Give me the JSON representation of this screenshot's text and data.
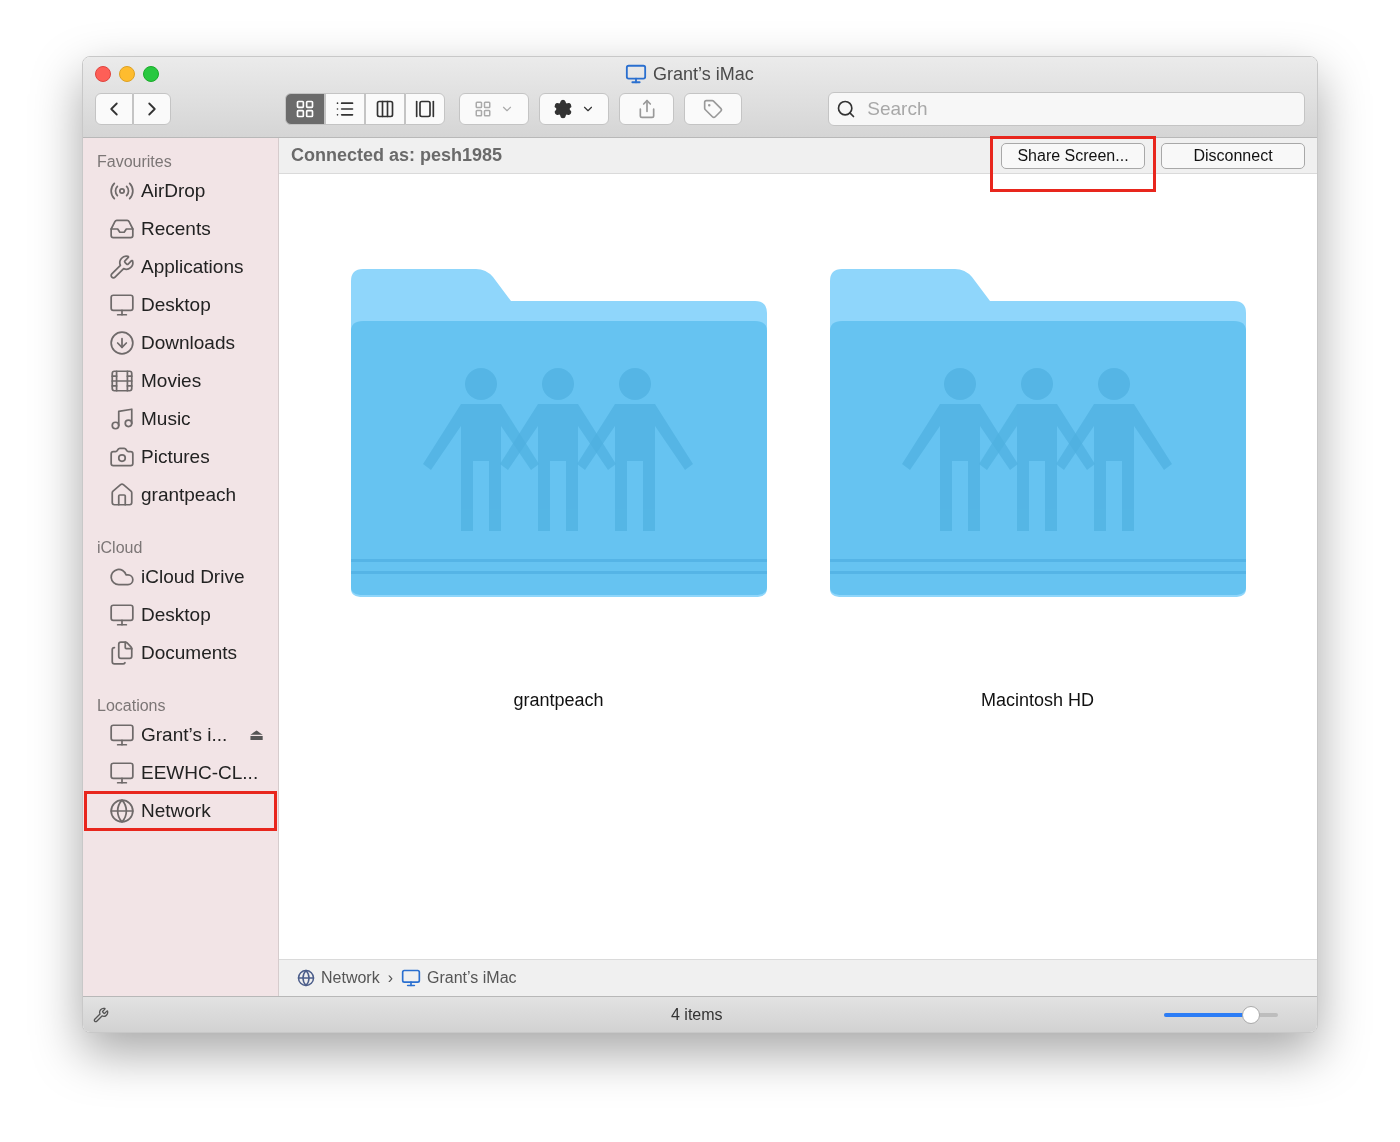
{
  "window": {
    "title": "Grant’s iMac"
  },
  "toolbar": {
    "view_buttons": [
      {
        "selected": true
      },
      {
        "selected": false
      },
      {
        "selected": false
      },
      {
        "selected": false
      }
    ],
    "search": {
      "placeholder": "Search"
    }
  },
  "sidebar": {
    "sections": [
      {
        "title": "Favourites",
        "items": [
          {
            "label": "AirDrop",
            "highlighted": false
          },
          {
            "label": "Recents",
            "highlighted": false
          },
          {
            "label": "Applications",
            "highlighted": false
          },
          {
            "label": "Desktop",
            "highlighted": false
          },
          {
            "label": "Downloads",
            "highlighted": false
          },
          {
            "label": "Movies",
            "highlighted": false
          },
          {
            "label": "Music",
            "highlighted": false
          },
          {
            "label": "Pictures",
            "highlighted": false
          },
          {
            "label": "grantpeach",
            "highlighted": false
          }
        ]
      },
      {
        "title": "iCloud",
        "items": [
          {
            "label": "iCloud Drive",
            "highlighted": false
          },
          {
            "label": "Desktop",
            "highlighted": false
          },
          {
            "label": "Documents",
            "highlighted": false
          }
        ]
      },
      {
        "title": "Locations",
        "items": [
          {
            "label": "Grant’s i...",
            "highlighted": false,
            "eject": "⏏"
          },
          {
            "label": "EEWHC-CL...",
            "highlighted": false
          },
          {
            "label": "Network",
            "highlighted": true
          }
        ]
      }
    ]
  },
  "connection_bar": {
    "text": "Connected as: pesh1985",
    "buttons": [
      {
        "label": "Share Screen...",
        "highlighted": true
      },
      {
        "label": "Disconnect",
        "highlighted": false
      }
    ]
  },
  "folders": [
    {
      "name": "grantpeach"
    },
    {
      "name": "Macintosh HD"
    }
  ],
  "path_bar": [
    {
      "label": "Network",
      "separator": "›"
    },
    {
      "label": "Grant’s iMac"
    }
  ],
  "status_bar": {
    "text": "4 items",
    "zoom": {
      "level": 0.76
    }
  }
}
